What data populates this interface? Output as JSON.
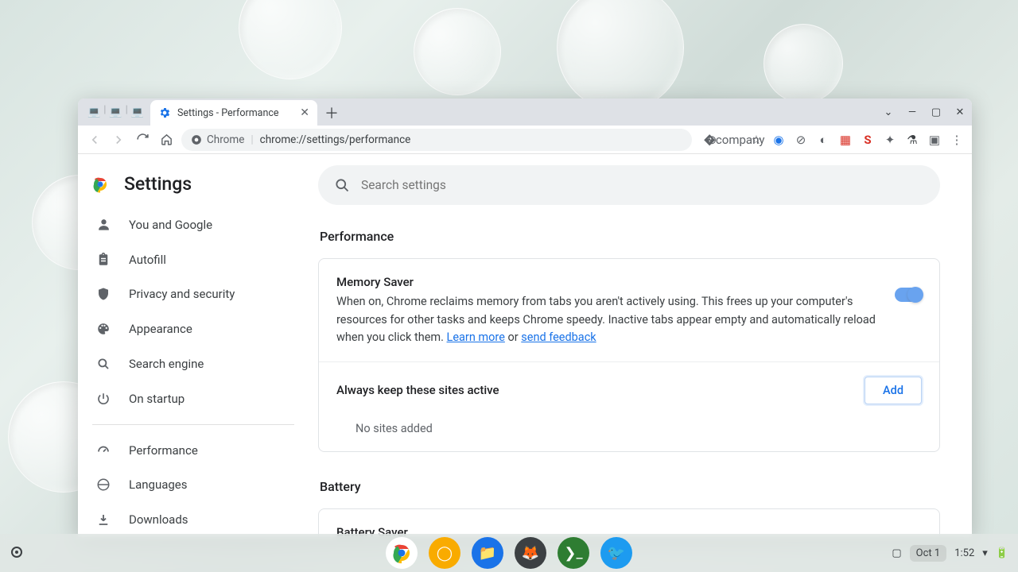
{
  "tab": {
    "title": "Settings - Performance"
  },
  "omnibox": {
    "chip": "Chrome",
    "url": "chrome://settings/performance"
  },
  "settings_title": "Settings",
  "search": {
    "placeholder": "Search settings"
  },
  "sidebar": {
    "items": [
      {
        "label": "You and Google"
      },
      {
        "label": "Autofill"
      },
      {
        "label": "Privacy and security"
      },
      {
        "label": "Appearance"
      },
      {
        "label": "Search engine"
      },
      {
        "label": "On startup"
      }
    ],
    "items2": [
      {
        "label": "Performance"
      },
      {
        "label": "Languages"
      },
      {
        "label": "Downloads"
      }
    ]
  },
  "sections": {
    "performance": {
      "title": "Performance",
      "memory_saver": {
        "title": "Memory Saver",
        "desc": "When on, Chrome reclaims memory from tabs you aren't actively using. This frees up your computer's resources for other tasks and keeps Chrome speedy. Inactive tabs appear empty and automatically reload when you click them. ",
        "learn_more": "Learn more",
        "or": " or ",
        "send_feedback": "send feedback"
      },
      "keep_active": {
        "title": "Always keep these sites active",
        "add": "Add",
        "empty": "No sites added"
      }
    },
    "battery": {
      "title": "Battery",
      "saver_title": "Battery Saver"
    }
  },
  "sys": {
    "date": "Oct 1",
    "time": "1:52"
  }
}
